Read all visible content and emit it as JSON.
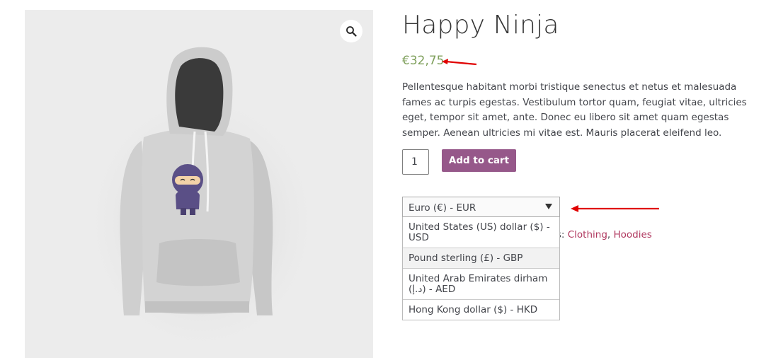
{
  "product": {
    "title": "Happy Ninja",
    "price": "€32,75",
    "description": "Pellentesque habitant morbi tristique senectus et netus et malesuada fames ac turpis egestas. Vestibulum tortor quam, feugiat vitae, ultricies eget, tempor sit amet, ante. Donec eu libero sit amet quam egestas semper. Aenean ultricies mi vitae est. Mauris placerat eleifend leo.",
    "quantity": "1",
    "add_to_cart_label": "Add to cart"
  },
  "gallery": {
    "zoom_icon": "magnifier-icon"
  },
  "currency": {
    "selected": "Euro (€) - EUR",
    "options": [
      {
        "label": "United States (US) dollar ($) - USD",
        "highlighted": false
      },
      {
        "label": "Pound sterling (£) - GBP",
        "highlighted": true
      },
      {
        "label": "United Arab Emirates dirham (د.إ) - AED",
        "highlighted": false
      },
      {
        "label": "Hong Kong dollar ($) - HKD",
        "highlighted": false
      }
    ]
  },
  "meta": {
    "categories_prefix": "ories:",
    "categories": [
      "Clothing",
      "Hoodies"
    ],
    "separator": ", "
  },
  "colors": {
    "price": "#7fa05c",
    "button": "#96588a",
    "link": "#b0385f",
    "annotation_arrow": "#e00000"
  }
}
